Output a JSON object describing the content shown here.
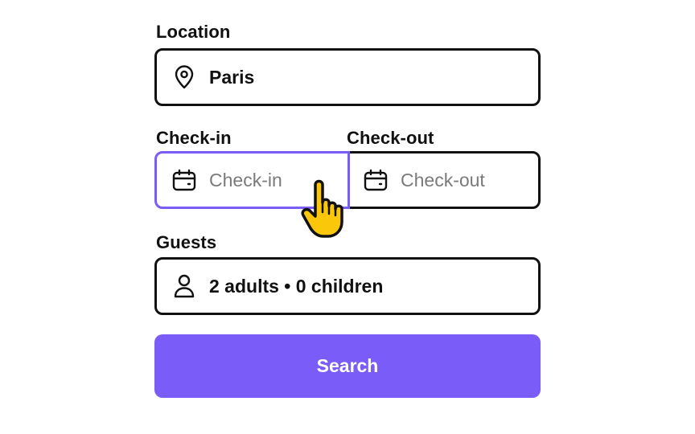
{
  "location": {
    "label": "Location",
    "value": "Paris",
    "icon": "map-pin-icon"
  },
  "dates": {
    "checkin_label": "Check-in",
    "checkin_placeholder": "Check-in",
    "checkout_label": "Check-out",
    "checkout_placeholder": "Check-out",
    "icon": "calendar-icon"
  },
  "guests": {
    "label": "Guests",
    "value": "2 adults • 0 children",
    "icon": "person-icon"
  },
  "search_button": {
    "label": "Search"
  },
  "colors": {
    "accent": "#7a5cf8",
    "focus_border": "#7a5cf6",
    "border": "#111111",
    "placeholder": "#7a7a7a",
    "cursor_fill": "#fbc70b"
  },
  "cursor": {
    "icon": "hand-pointer-icon"
  }
}
